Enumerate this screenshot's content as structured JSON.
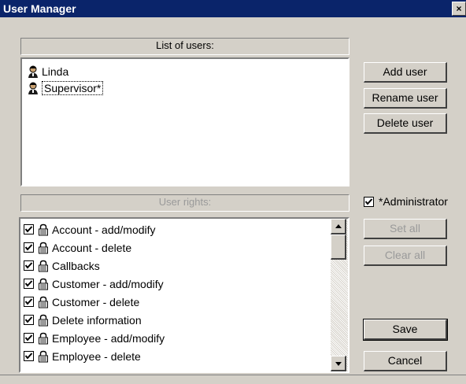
{
  "window": {
    "title": "User Manager",
    "close_label": "×"
  },
  "users_panel": {
    "header": "List of users:",
    "users": [
      {
        "name": "Linda",
        "focused": false
      },
      {
        "name": "Supervisor*",
        "focused": true
      }
    ]
  },
  "user_buttons": {
    "add": "Add user",
    "rename": "Rename user",
    "delete": "Delete user"
  },
  "rights_panel": {
    "header": "User rights:",
    "rights": [
      {
        "label": "Account - add/modify",
        "checked": true
      },
      {
        "label": "Account - delete",
        "checked": true
      },
      {
        "label": "Callbacks",
        "checked": true
      },
      {
        "label": "Customer - add/modify",
        "checked": true
      },
      {
        "label": "Customer - delete",
        "checked": true
      },
      {
        "label": "Delete information",
        "checked": true
      },
      {
        "label": "Employee - add/modify",
        "checked": true
      },
      {
        "label": "Employee - delete",
        "checked": true
      }
    ]
  },
  "administrator": {
    "label": "*Administrator",
    "checked": true
  },
  "rights_buttons": {
    "set_all": "Set all",
    "clear_all": "Clear all"
  },
  "dialog_buttons": {
    "save": "Save",
    "cancel": "Cancel"
  },
  "icons": {
    "user": "user-icon",
    "lock": "lock-icon",
    "check": "check-icon",
    "scroll_up": "arrow-up-icon",
    "scroll_down": "arrow-down-icon"
  }
}
